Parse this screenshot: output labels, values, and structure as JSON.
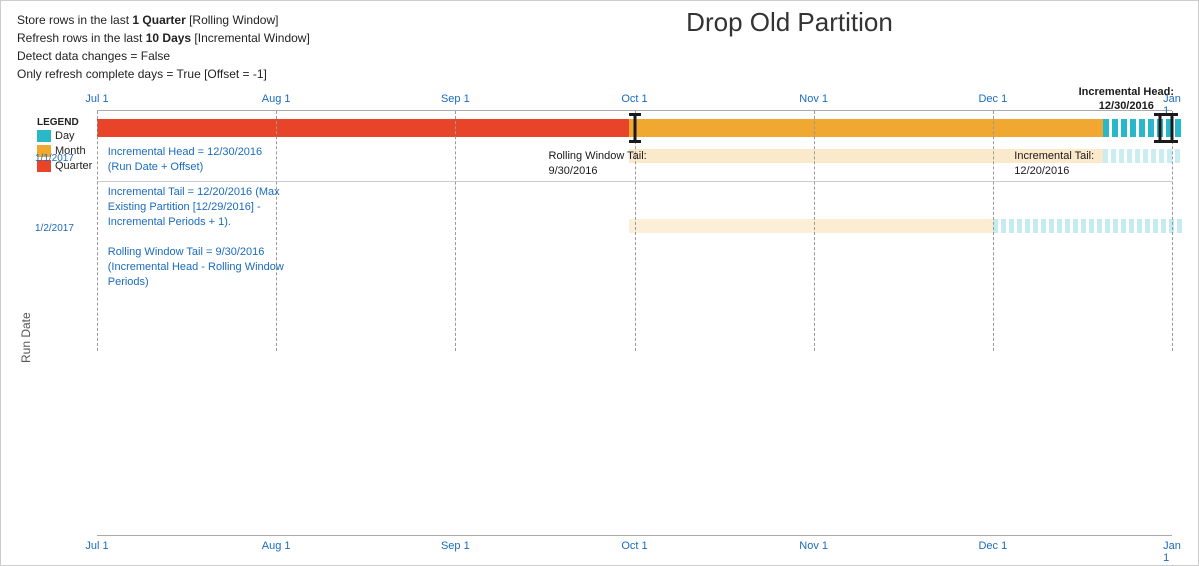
{
  "title": "Drop Old Partition",
  "info": {
    "line1_pre": "Store rows in the last ",
    "line1_bold": "1 Quarter",
    "line1_post": " [Rolling Window]",
    "line2_pre": "Refresh rows in the last ",
    "line2_bold": "10 Days",
    "line2_post": " [Incremental Window]",
    "line3": "Detect data changes = False",
    "line4": "Only refresh complete days = True [Offset = -1]"
  },
  "inc_head_annotation": {
    "line1": "Incremental Head:",
    "line2": "12/30/2016"
  },
  "axis_labels": [
    "Jul 1",
    "Aug 1",
    "Sep 1",
    "Oct 1",
    "Nov 1",
    "Dec 1",
    "Jan 1"
  ],
  "legend": {
    "title": "LEGEND",
    "items": [
      {
        "label": "Day",
        "color": "#2ab8c8"
      },
      {
        "label": "Month",
        "color": "#f0a830"
      },
      {
        "label": "Quarter",
        "color": "#e8442a"
      }
    ]
  },
  "annotations": {
    "inc_head": "Incremental Head = 12/30/2016\n(Run Date + Offset)",
    "inc_tail": "Incremental Tail = 12/20/2016 (Max\nExisting Partition [12/29/2016] -\nIncremental Periods + 1).",
    "roll_tail": "Rolling Window Tail = 9/30/2016\n(Incremental Head - Rolling Window\nPeriods)",
    "rw_tail_label": "Rolling Window Tail:\n9/30/2016",
    "inc_tail_label": "Incremental Tail:\n12/20/2016"
  },
  "run_dates": [
    "1/1/2017",
    "1/2/2017"
  ],
  "y_axis_label": "Run Date"
}
